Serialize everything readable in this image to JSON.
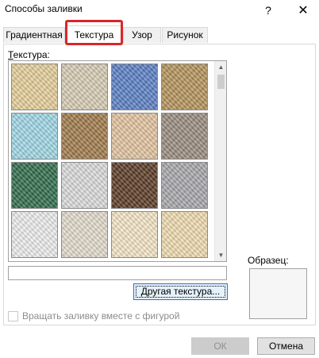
{
  "window": {
    "title": "Способы заливки",
    "help_label": "?",
    "close_label": "✕"
  },
  "tabs": [
    {
      "label": "Градиентная",
      "active": false
    },
    {
      "label": "Текстура",
      "active": true
    },
    {
      "label": "Узор",
      "active": false
    },
    {
      "label": "Рисунок",
      "active": false
    }
  ],
  "texture_panel": {
    "label": "Текстура:",
    "label_mnemonic": "Т",
    "label_rest": "екстура:",
    "texture_name_value": "",
    "textures": [
      {
        "name": "papyrus",
        "color": "#e6cf9a"
      },
      {
        "name": "canvas",
        "color": "#d8ccb4"
      },
      {
        "name": "denim",
        "color": "#5a7fc4"
      },
      {
        "name": "woven-mat",
        "color": "#b4935a"
      },
      {
        "name": "water-droplets",
        "color": "#9fd8e6"
      },
      {
        "name": "paper-bag",
        "color": "#a07a4a"
      },
      {
        "name": "fish-fossil",
        "color": "#e3c4a0"
      },
      {
        "name": "sand",
        "color": "#9a8c80"
      },
      {
        "name": "green-marble",
        "color": "#2f6b4a"
      },
      {
        "name": "white-marble",
        "color": "#dcdcdc"
      },
      {
        "name": "brown-marble",
        "color": "#5a3a24"
      },
      {
        "name": "granite",
        "color": "#a8a8ac"
      },
      {
        "name": "newsprint",
        "color": "#eeeeee"
      },
      {
        "name": "recycled-paper",
        "color": "#e4dccc"
      },
      {
        "name": "parchment",
        "color": "#f5e6c6"
      },
      {
        "name": "stationery",
        "color": "#f0dcb0"
      }
    ]
  },
  "other_texture_button": {
    "mnemonic": "Д",
    "rest": "ругая текстура..."
  },
  "sample": {
    "label": "Образец:"
  },
  "rotate_checkbox": {
    "label": "Вращать заливку вместе с фигурой",
    "checked": false,
    "enabled": false
  },
  "buttons": {
    "ok": "ОК",
    "cancel": "Отмена"
  }
}
